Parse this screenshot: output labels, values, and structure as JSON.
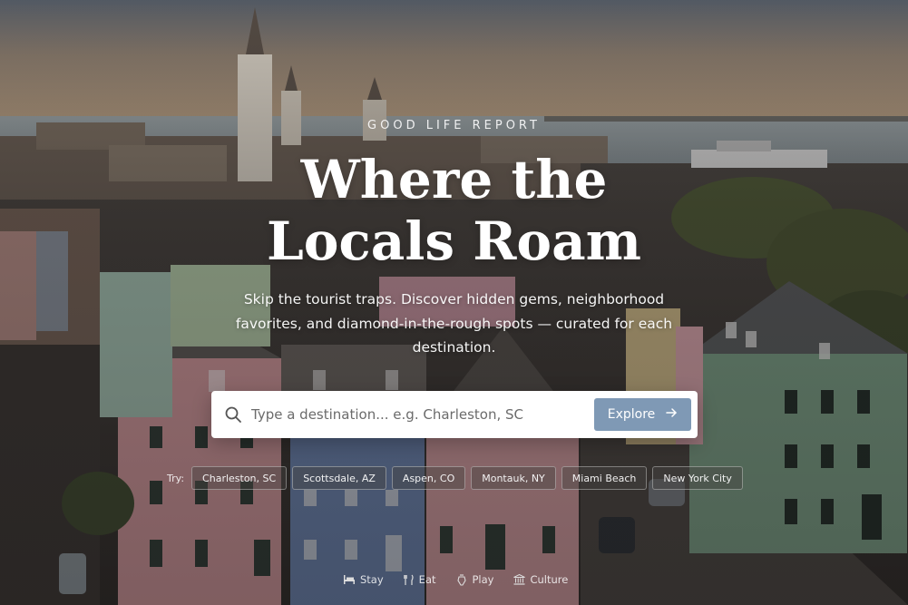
{
  "hero": {
    "eyebrow": "GOOD LIFE REPORT",
    "title_line1": "Where the",
    "title_line2": "Locals Roam",
    "subtitle": "Skip the tourist traps. Discover hidden gems, neighborhood favorites, and diamond-in-the-rough spots — curated for each destination."
  },
  "search": {
    "placeholder": "Type a destination... e.g. Charleston, SC",
    "value": "",
    "button_label": "Explore",
    "icon": "search-icon",
    "button_icon": "arrow-right-icon"
  },
  "suggestions": {
    "label": "Try:",
    "items": [
      "Charleston, SC",
      "Scottsdale, AZ",
      "Aspen, CO",
      "Montauk, NY",
      "Miami Beach",
      "New York City"
    ]
  },
  "categories": [
    {
      "label": "Stay",
      "icon": "bed-icon"
    },
    {
      "label": "Eat",
      "icon": "utensils-icon"
    },
    {
      "label": "Play",
      "icon": "play-icon"
    },
    {
      "label": "Culture",
      "icon": "museum-icon"
    }
  ],
  "colors": {
    "accent": "#7f99b5",
    "text": "#ffffff"
  }
}
